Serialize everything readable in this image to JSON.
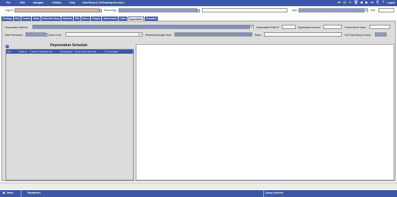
{
  "menu": {
    "file": "File",
    "edit": "Edit",
    "navigate": "Navigate",
    "utilities": "Utilities",
    "help": "Help",
    "new_record": "New Record ( 18 Existing Records )",
    "logout": "Logout"
  },
  "header": {
    "eqp_id_label": "Eqp ID",
    "eqp_id_value": "",
    "parent_eqp_label": "Parent Eqp",
    "parent_eqp_value": "",
    "description_value": "",
    "type_label": "Type",
    "type_value": "",
    "rev_label": "Rev",
    "rev_value": ""
  },
  "tabs": [
    "Costings",
    "Main",
    "Vendor",
    "Safety",
    "Notes/Job Steps",
    "Materials",
    "PMs",
    "Meters",
    "Gauges",
    "Attachments",
    "Costs",
    "Depreciation",
    "Downtime"
  ],
  "depreciation": {
    "method_label": "Depreciation Method",
    "method_value": "",
    "rate_label": "Depreciation Rate %",
    "rate_value": "",
    "amount_label": "Depreciated Amount",
    "amount_value": "",
    "current_book_label": "Current Book Value",
    "current_book_value": "",
    "date_purchased_label": "Date Purchased",
    "date_purchased_value": "",
    "asset_cost_label": "Asset Cost",
    "asset_cost_value": "$ 0",
    "residual_label": "Residual/Salvage Value",
    "residual_value": "",
    "basis_label": "Basis",
    "basis_value": "",
    "life_label": "Life Expectancy (Years)",
    "life_value": ""
  },
  "schedule": {
    "title": "Depreciation Schedule",
    "columns": [
      "Year",
      "Rate %",
      "Start of Year Book Val...",
      "Depreciated",
      "End of Year Book Val...",
      "Accumulated"
    ]
  },
  "taskbar": {
    "menu": "Menu",
    "equipment": "Equipment",
    "status": "Query Success"
  },
  "colors": {
    "primary": "#3d57a8",
    "required_field": "#f1a6a6",
    "lookup_field": "#8a9cd0",
    "panel_bg": "#dcdcdc"
  }
}
